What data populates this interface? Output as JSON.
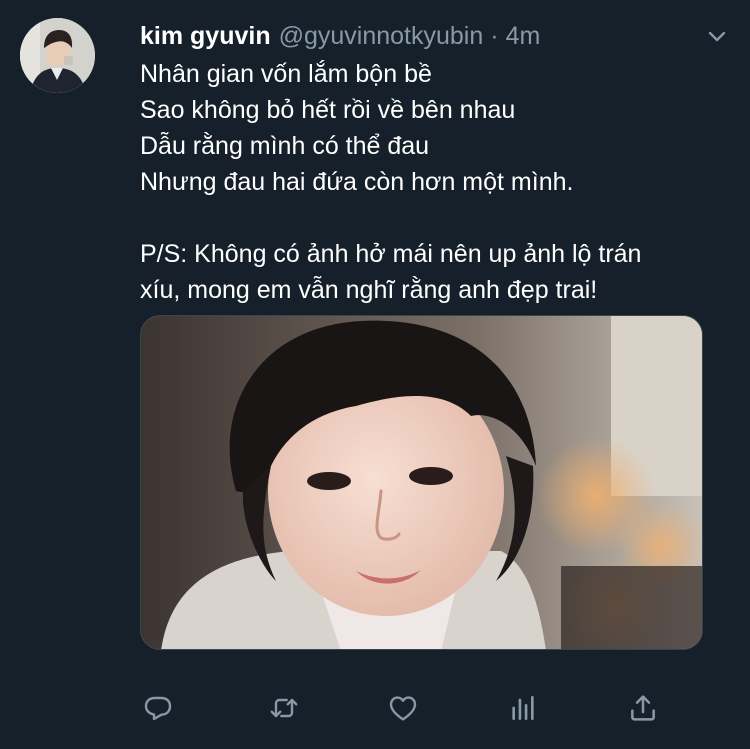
{
  "tweet": {
    "author": {
      "display_name": "kim gyuvin",
      "handle": "@gyuvinnotkyubin",
      "separator": "·",
      "time": "4m",
      "avatar": "profile-avatar"
    },
    "text_lines": [
      "Nhân gian vốn lắm bộn bề",
      "Sao không bỏ hết rồi về bên nhau",
      "Dẫu rằng mình có thể đau",
      "Nhưng đau hai đứa còn hơn một mình.",
      "",
      "P/S: Không có ảnh hở mái nên up ảnh lộ trán",
      "xíu, mong em vẫn nghĩ rằng anh đẹp trai!"
    ],
    "media": {
      "kind": "photo"
    },
    "icons": {
      "more": "chevron-down-icon",
      "reply": "reply-icon",
      "retweet": "retweet-icon",
      "like": "heart-icon",
      "analytics": "analytics-icon",
      "share": "share-icon"
    },
    "colors": {
      "background": "#15202b",
      "primary_text": "#ffffff",
      "secondary_text": "#8899a6",
      "border": "#38444d"
    }
  }
}
